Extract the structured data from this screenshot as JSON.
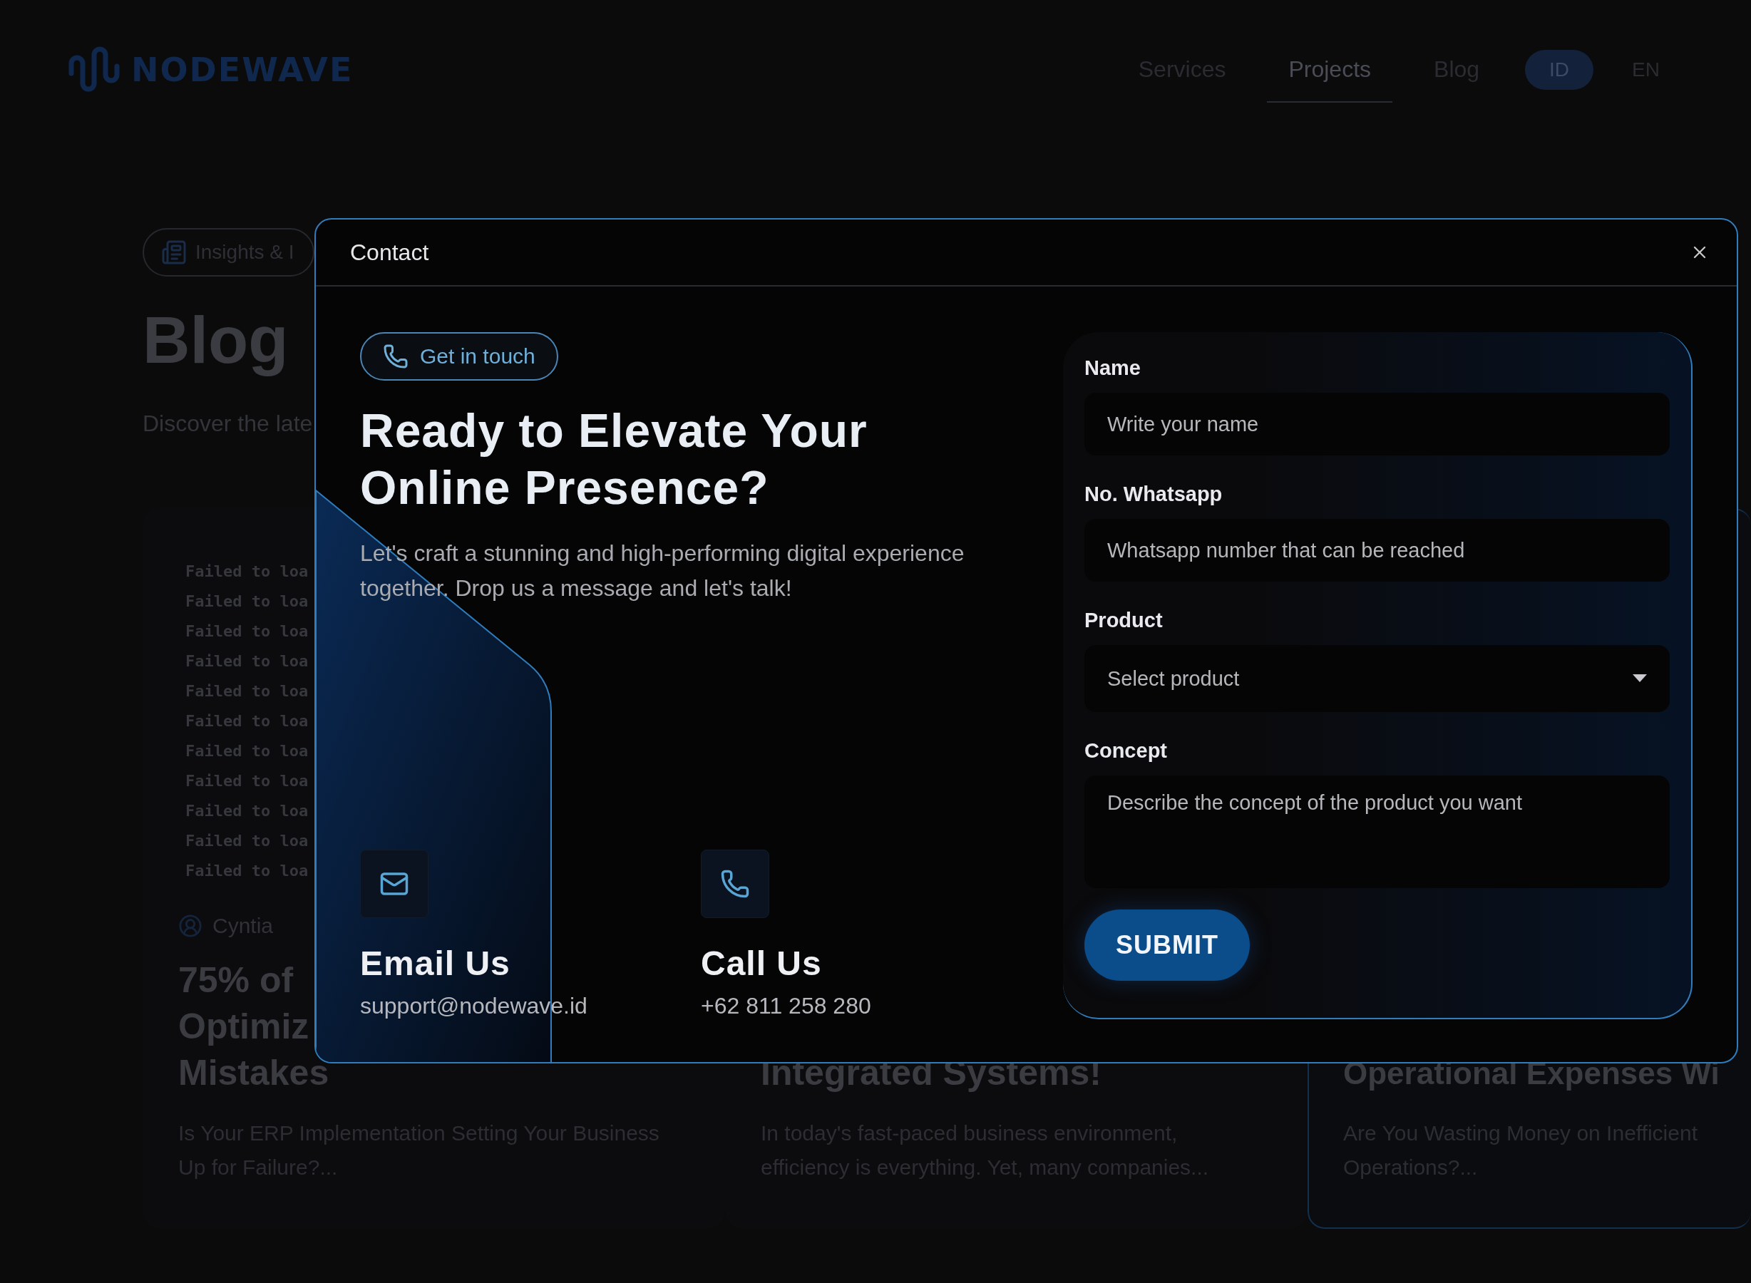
{
  "nav": {
    "logo": "NODEWAVE",
    "links": [
      {
        "label": "Services",
        "selected": false
      },
      {
        "label": "Projects",
        "selected": true
      },
      {
        "label": "Blog",
        "selected": false
      }
    ],
    "languages": [
      {
        "label": "ID",
        "selected": true
      },
      {
        "label": "EN",
        "selected": false
      }
    ]
  },
  "hero": {
    "badge": "Insights & I",
    "title": "Blog",
    "subtitle": "Discover the late"
  },
  "cards": [
    {
      "highlighted": false,
      "image_lines": [
        "Failed to loa",
        "Failed to loa",
        "Failed to loa",
        "Failed to loa",
        "Failed to loa",
        "Failed to loa",
        "Failed to loa",
        "Failed to loa",
        "Failed to loa",
        "Failed to loa",
        "Failed to loa"
      ],
      "author": "Cyntia",
      "title_lines": [
        "75% of",
        "Optimiz",
        "Mistakes"
      ],
      "excerpt": "Is Your ERP Implementation Setting Your Business Up for Failure?..."
    },
    {
      "highlighted": false,
      "title_lines": [
        "Integrated Systems!"
      ],
      "excerpt": "In today's fast-paced business environment, efficiency is everything. Yet, many companies..."
    },
    {
      "highlighted": true,
      "title_lines": [
        "Operational Expenses Wi"
      ],
      "excerpt": "Are You Wasting Money on Inefficient Operations?..."
    }
  ],
  "modal": {
    "title": "Contact",
    "badge": "Get in touch",
    "headline": "Ready to Elevate Your Online Presence?",
    "text": "Let's craft a stunning and high-performing digital experience together. Drop us a message and let's talk!",
    "contacts": [
      {
        "kind": "email",
        "title": "Email Us",
        "value": "support@nodewave.id"
      },
      {
        "kind": "phone",
        "title": "Call Us",
        "value": "+62 811 258 280"
      }
    ],
    "fields": [
      {
        "kind": "text",
        "label": "Name",
        "placeholder": "Write your name"
      },
      {
        "kind": "text",
        "label": "No. Whatsapp",
        "placeholder": "Whatsapp number that can be reached"
      },
      {
        "kind": "select",
        "label": "Product",
        "placeholder": "Select product"
      },
      {
        "kind": "textarea",
        "label": "Concept",
        "placeholder": "Describe the concept of the product you want"
      }
    ],
    "submit": "SUBMIT"
  }
}
